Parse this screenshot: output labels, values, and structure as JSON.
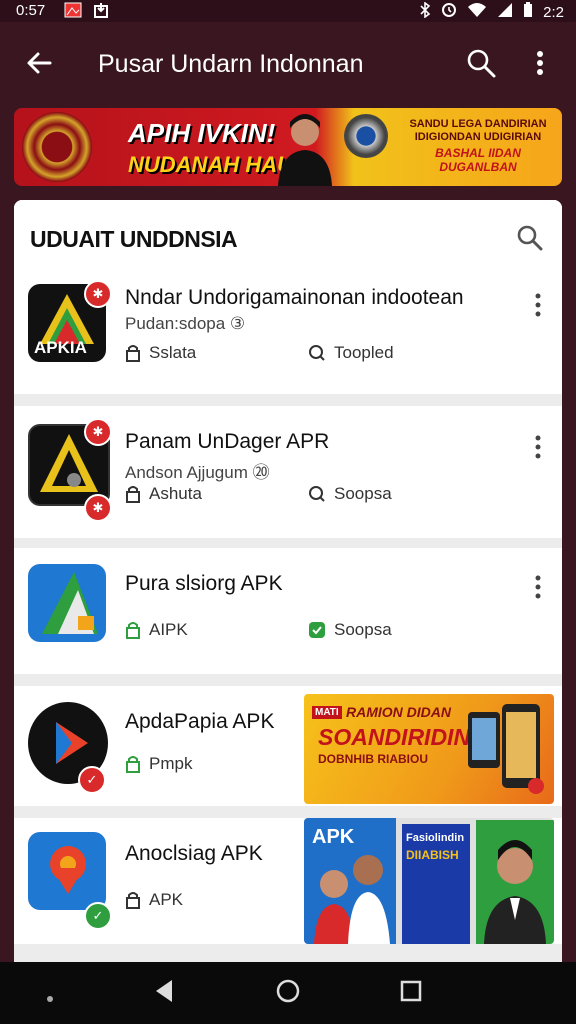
{
  "status_bar": {
    "time": "0:57",
    "clock": "2:2"
  },
  "app_bar": {
    "title": "Pusar Undarn Indonnan"
  },
  "banner": {
    "headline": "APIH IVKIN!",
    "subheadline": "NUDANAH HAU",
    "side_text_1": "SANDU LEGA DANDIRIAN IDIGIONDAN UDIGIRIAN",
    "side_text_2": "BASHAL IIDAN DUGANLBAN"
  },
  "section": {
    "title": "UDUAIT UNDDNSIA"
  },
  "apps": [
    {
      "name": "Nndar Undorigamainonan indootean",
      "subtitle": "Pudan:sdopa ③",
      "meta_left": "Sslata",
      "meta_right": "Toopled",
      "icon_text": "APKIA"
    },
    {
      "name": "Panam UnDager APR",
      "subtitle": "Andson Ajjugum ⑳",
      "meta_left": "Ashuta",
      "meta_right": "Soopsa"
    },
    {
      "name": "Pura slsiorg APK",
      "subtitle": "",
      "meta_left": "AIPK",
      "meta_right": "Soopsa"
    },
    {
      "name": "ApdaPapia APK",
      "subtitle": "",
      "meta_left": "Pmpk",
      "meta_right": ""
    },
    {
      "name": "Anoclsiag APK",
      "subtitle": "",
      "meta_left": "APK",
      "meta_right": ""
    }
  ],
  "promo_1": {
    "tag": "MATI",
    "line1": "RAMION DIDAN",
    "line2": "SOANDIRIDIN",
    "line3": "DOBNHIB RIABIOU"
  },
  "promo_2": {
    "label": "APK",
    "tile_line1": "Fasiolindin",
    "tile_line2": "DIIABISH"
  },
  "colors": {
    "app_bar": "#3a1620",
    "accent_red": "#d82a2a",
    "accent_green": "#2e9e3e"
  }
}
